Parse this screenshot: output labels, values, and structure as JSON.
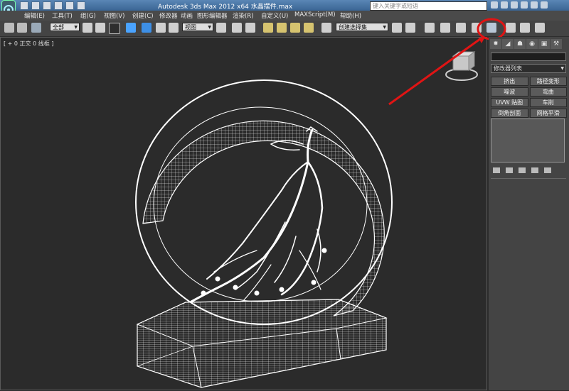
{
  "window": {
    "title": "Autodesk 3ds Max  2012 x64     水晶摆件.max",
    "search_placeholder": "键入关键字或短语"
  },
  "menu": [
    "编辑(E)",
    "工具(T)",
    "组(G)",
    "视图(V)",
    "创建(C)",
    "修改器",
    "动画",
    "图形编辑器",
    "渲染(R)",
    "自定义(U)",
    "MAXScript(M)",
    "帮助(H)"
  ],
  "toolbar": {
    "selection_filter": "全部",
    "reference_coord": "视图",
    "named_selection": "创建选择集"
  },
  "viewport": {
    "label": "[ + 0 正交 0 线框 ]",
    "background_color": "#2b2b2b",
    "wire_color": "#ffffff"
  },
  "command_panel": {
    "modifier_list": "修改器列表",
    "buttons": [
      "挤出",
      "路径变形",
      "噪波",
      "弯曲",
      "UVW 贴图",
      "车削",
      "倒角剖面",
      "网格平滑"
    ]
  },
  "annotation": {
    "arrow_color": "#e01414",
    "target": "render-setup-button"
  }
}
